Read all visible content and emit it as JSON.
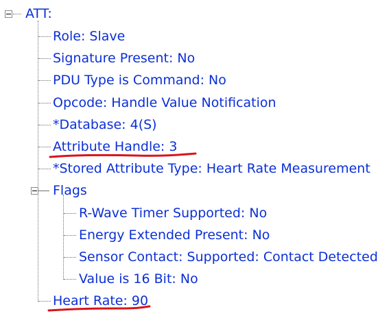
{
  "tree": {
    "root": {
      "label": "ATT:",
      "expanded": true,
      "children": [
        {
          "label": "Role: Slave"
        },
        {
          "label": "Signature Present: No"
        },
        {
          "label": "PDU Type is Command: No"
        },
        {
          "label": "Opcode: Handle Value Notification"
        },
        {
          "label": "*Database: 4(S)"
        },
        {
          "label": "Attribute Handle: 3",
          "underlined": true
        },
        {
          "label": "*Stored Attribute Type: Heart Rate Measurement"
        },
        {
          "label": "Flags",
          "expanded": true,
          "children": [
            {
              "label": "R-Wave Timer Supported: No"
            },
            {
              "label": "Energy Extended Present: No"
            },
            {
              "label": "Sensor Contact: Supported: Contact Detected"
            },
            {
              "label": "Value is 16 Bit: No"
            }
          ]
        },
        {
          "label": "Heart Rate: 90",
          "underlined": true
        }
      ]
    }
  },
  "colors": {
    "text": "#0b2fd6",
    "tree_lines": "#6e6e6e",
    "underline_annotation": "#d8141b"
  }
}
